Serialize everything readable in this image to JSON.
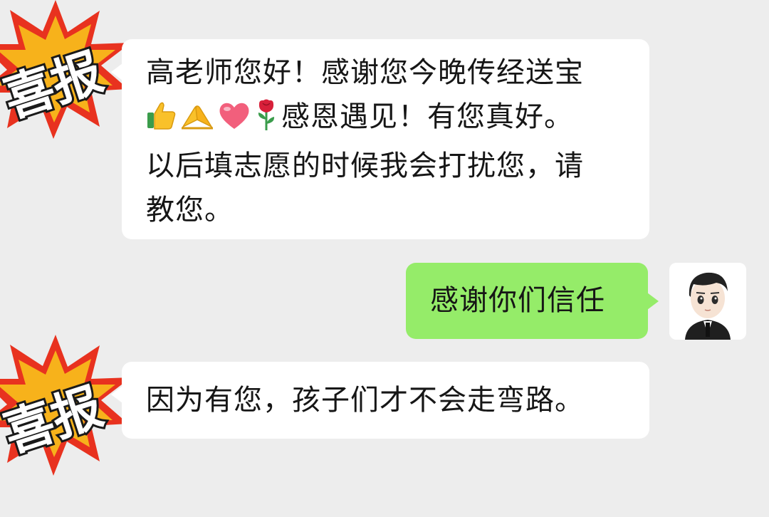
{
  "conversation": {
    "messages": [
      {
        "sender": "incoming",
        "lines": [
          "高老师您好！感谢您今晚传经送宝",
          "感恩遇见！有您真好。",
          "以后填志愿的时候我会打扰您，请",
          "教您。"
        ],
        "emojis": [
          "thumbs-up-icon",
          "folded-hands-icon",
          "heart-icon",
          "rose-icon"
        ]
      },
      {
        "sender": "outgoing",
        "text": "感谢你们信任"
      },
      {
        "sender": "incoming",
        "text": "因为有您，孩子们才不会走弯路。"
      }
    ]
  },
  "badges": [
    {
      "text": "喜报"
    },
    {
      "text": "喜报"
    }
  ],
  "colors": {
    "background": "#ededed",
    "incoming_bubble": "#ffffff",
    "outgoing_bubble": "#95ec69",
    "badge_fill": "#e8321f",
    "badge_inner": "#f7b21b"
  },
  "avatar": {
    "icon": "cartoon-man-avatar-icon"
  }
}
